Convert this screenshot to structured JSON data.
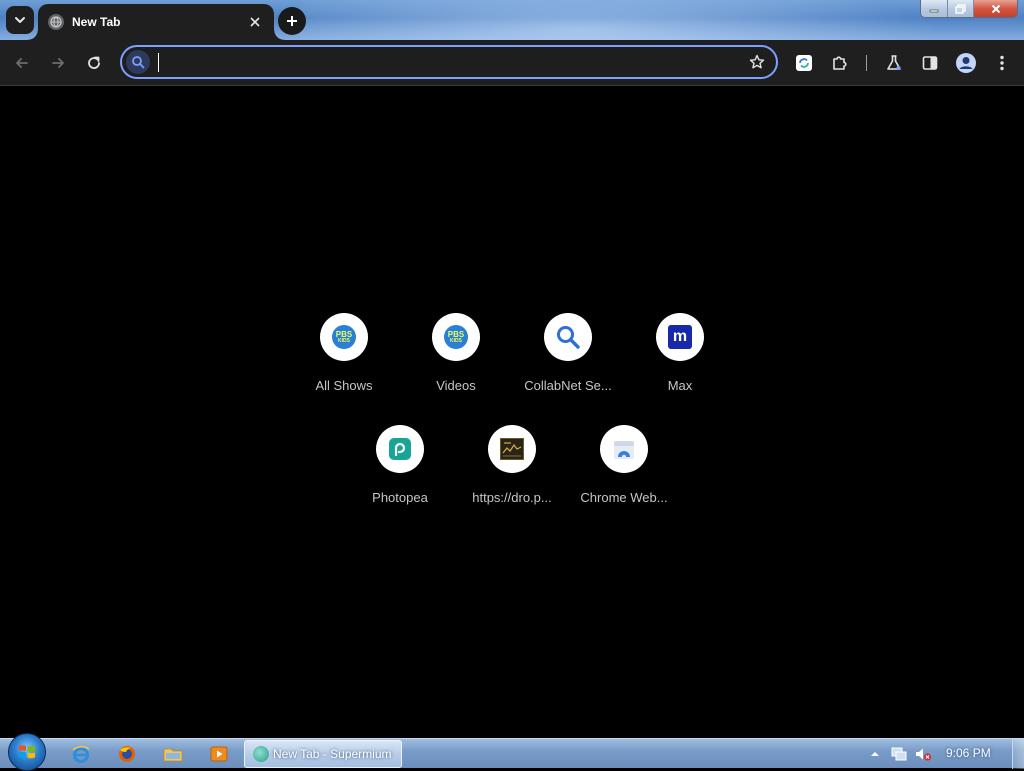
{
  "browser": {
    "tab": {
      "title": "New Tab"
    },
    "omnibox": {
      "value": "",
      "placeholder": ""
    }
  },
  "shortcuts": [
    {
      "label": "All Shows",
      "icon": "pbs-kids-icon"
    },
    {
      "label": "Videos",
      "icon": "pbs-kids-icon"
    },
    {
      "label": "CollabNet Se...",
      "icon": "search-icon"
    },
    {
      "label": "Max",
      "icon": "max-icon"
    },
    {
      "label": "Photopea",
      "icon": "photopea-icon"
    },
    {
      "label": "https://dro.p...",
      "icon": "site-thumbnail-icon"
    },
    {
      "label": "Chrome Web...",
      "icon": "chrome-web-store-icon"
    }
  ],
  "pbs_logo": {
    "top": "PBS",
    "bottom": "KIDS"
  },
  "max_logo": "m",
  "taskbar": {
    "window_label": "New Tab - Supermium",
    "clock": "9:06 PM"
  },
  "colors": {
    "page_bg": "#000000",
    "toolbar_bg": "#1f1f1f",
    "omnibox_focus": "#7ca0ff",
    "shortcut_label": "#c4c7c5"
  }
}
